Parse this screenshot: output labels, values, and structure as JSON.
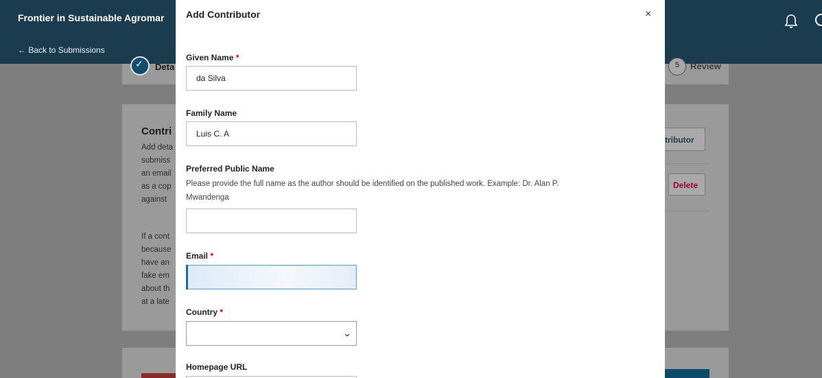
{
  "background": {
    "journal_title": "Frontier in Sustainable Agromar",
    "back_link": "← Back to Submissions",
    "steps": {
      "step1_label": "Deta",
      "step5_number": "5",
      "step5_label": "Review"
    },
    "section_title": "Contri",
    "section_text_lines": [
      "Add deta",
      "submiss",
      "an email",
      "as a cop",
      "against"
    ],
    "section_text2_lines": [
      "If a cont",
      "because",
      "have an",
      "fake em",
      "about th",
      "at a late"
    ],
    "add_contributor_label": "tributor",
    "delete_label": "Delete"
  },
  "modal": {
    "title": "Add Contributor",
    "close_glyph": "×",
    "fields": {
      "given_name": {
        "label": "Given Name",
        "required_mark": "*",
        "value": "da Silva"
      },
      "family_name": {
        "label": "Family Name",
        "value": "Luis C. A"
      },
      "preferred_name": {
        "label": "Preferred Public Name",
        "description_line1": "Please provide the full name as the author should be identified on the published work. Example: Dr. Alan P.",
        "description_line2": "Mwandenga",
        "value": ""
      },
      "email": {
        "label": "Email",
        "required_mark": "*",
        "value": ""
      },
      "country": {
        "label": "Country",
        "required_mark": "*",
        "selected": ""
      },
      "homepage": {
        "label": "Homepage URL"
      }
    }
  },
  "colors": {
    "header_bg": "#1b3c4e",
    "required": "#d00000",
    "delete": "#a3003a",
    "focus": "#6aa6d6"
  }
}
